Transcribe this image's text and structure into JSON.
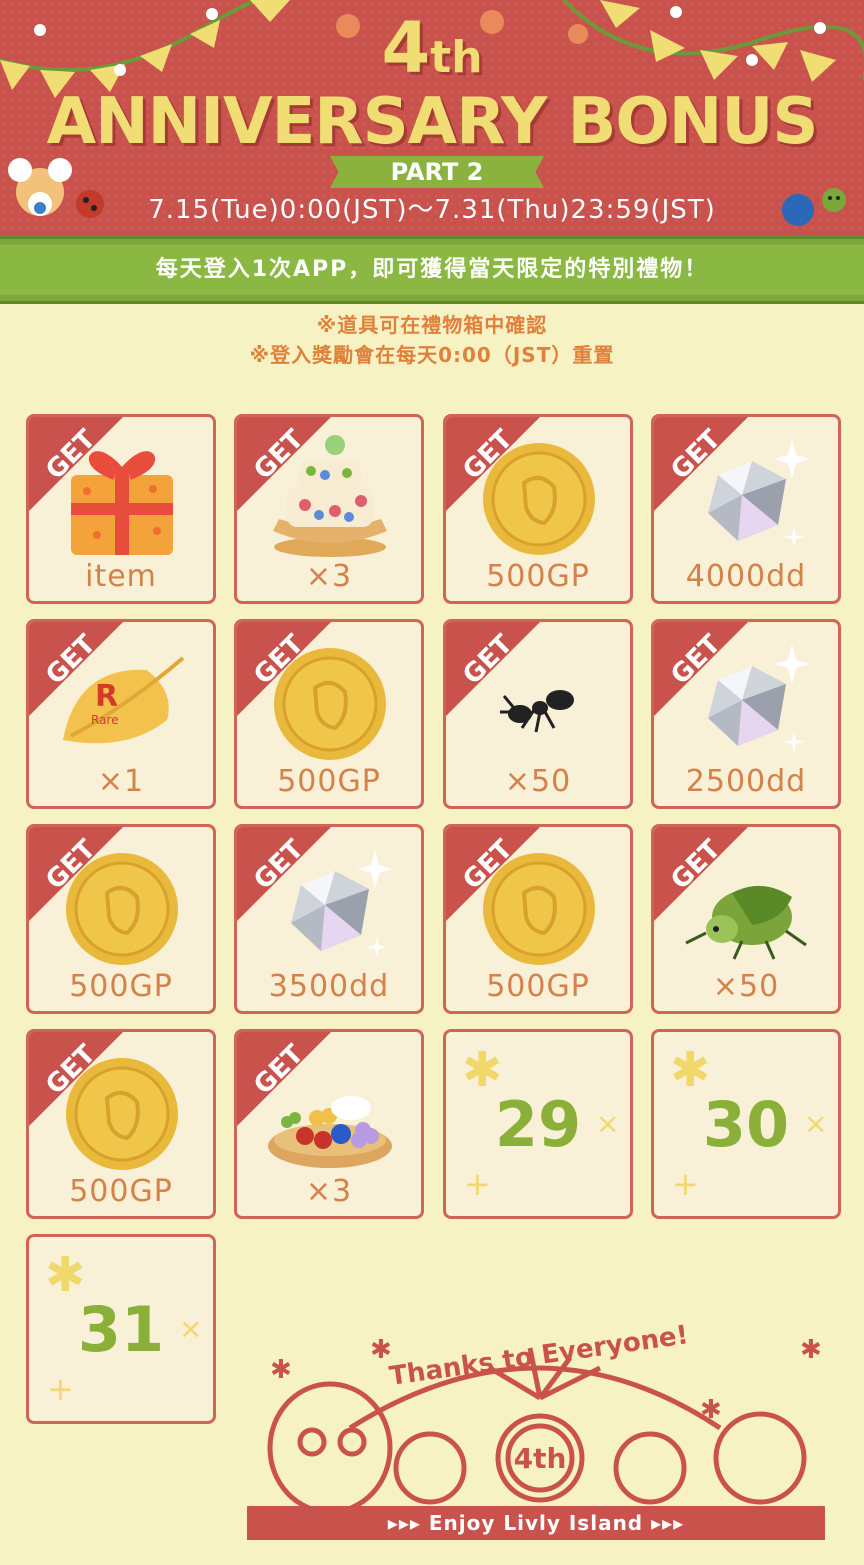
{
  "header": {
    "fourth_main": "4",
    "fourth_sup": "th",
    "title": "ANNIVERSARY BONUS",
    "part": "PART 2",
    "period": "7.15(Tue)0:00(JST)～7.31(Thu)23:59(JST)"
  },
  "ribbon": {
    "text": "每天登入1次APP，即可獲得當天限定的特別禮物！"
  },
  "notes": {
    "line1": "※道具可在禮物箱中確認",
    "line2": "※登入獎勵會在每天0:00（JST）重置"
  },
  "get_label": "GET",
  "rewards": [
    {
      "label": "item",
      "icon": "gift-box-icon",
      "claimed": true
    },
    {
      "label": "×3",
      "icon": "cake-icon",
      "claimed": true
    },
    {
      "label": "500GP",
      "icon": "gold-coin-icon",
      "claimed": true
    },
    {
      "label": "4000dd",
      "icon": "diamond-icon",
      "claimed": true
    },
    {
      "label": "×1",
      "icon": "rare-leaf-icon",
      "claimed": true
    },
    {
      "label": "500GP",
      "icon": "gold-coin-icon",
      "claimed": true
    },
    {
      "label": "×50",
      "icon": "ant-icon",
      "claimed": true
    },
    {
      "label": "2500dd",
      "icon": "diamond-icon",
      "claimed": true
    },
    {
      "label": "500GP",
      "icon": "gold-coin-icon",
      "claimed": true
    },
    {
      "label": "3500dd",
      "icon": "diamond-icon",
      "claimed": true
    },
    {
      "label": "500GP",
      "icon": "gold-coin-icon",
      "claimed": true
    },
    {
      "label": "×50",
      "icon": "green-bug-icon",
      "claimed": true
    },
    {
      "label": "500GP",
      "icon": "gold-coin-icon",
      "claimed": true
    },
    {
      "label": "×3",
      "icon": "bug-tart-icon",
      "claimed": true
    }
  ],
  "upcoming_days": [
    "29",
    "30",
    "31"
  ],
  "footer": {
    "thanks": "Thanks to Everyone!",
    "badge": "4th",
    "band": "▸▸▸ Enjoy Livly Island ▸▸▸"
  },
  "colors": {
    "banner_red": "#c9524c",
    "title_yellow": "#f0de74",
    "ribbon_green": "#8ab842",
    "page_bg": "#f7f2c4",
    "label_orange": "#d5814a",
    "day_green": "#8ab03a"
  }
}
